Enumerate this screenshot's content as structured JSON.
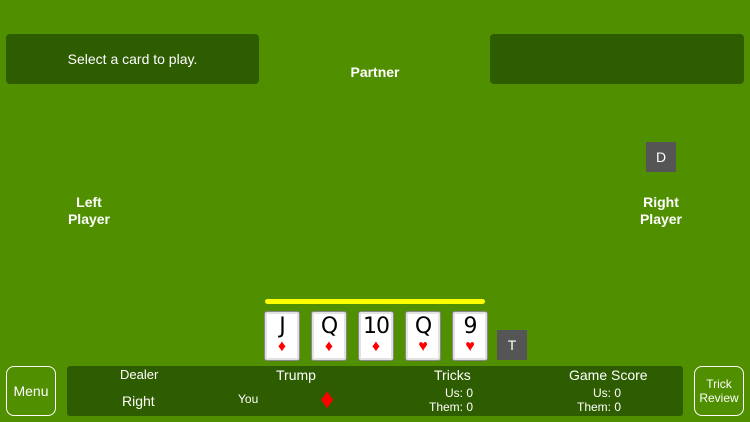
{
  "message": "Select a card to play.",
  "right_message": "",
  "players": {
    "partner": "Partner",
    "left": [
      "Left",
      "Player"
    ],
    "right": [
      "Right",
      "Player"
    ]
  },
  "markers": {
    "dealer": "D",
    "trump": "T"
  },
  "hand": [
    {
      "rank": "J",
      "suit": "♦",
      "suit_name": "diamonds"
    },
    {
      "rank": "Q",
      "suit": "♦",
      "suit_name": "diamonds"
    },
    {
      "rank": "10",
      "suit": "♦",
      "suit_name": "diamonds"
    },
    {
      "rank": "Q",
      "suit": "♥",
      "suit_name": "hearts"
    },
    {
      "rank": "9",
      "suit": "♥",
      "suit_name": "hearts"
    }
  ],
  "buttons": {
    "menu": "Menu",
    "trick_review": [
      "Trick",
      "Review"
    ]
  },
  "status": {
    "dealer_label": "Dealer",
    "dealer_value": "Right",
    "trump_label": "Trump",
    "trump_caller": "You",
    "trump_suit": "♦",
    "tricks_label": "Tricks",
    "tricks_us": "Us:  0",
    "tricks_them": "Them:  0",
    "game_score_label": "Game Score",
    "score_us": "Us:  0",
    "score_them": "Them:  0"
  },
  "colors": {
    "table": "#4f8f00",
    "panel": "#2e5c00",
    "turn_indicator": "#ffff00",
    "red_suit": "#ff0000",
    "marker": "#555555"
  },
  "icons": {
    "trump_suit": "diamond-icon"
  }
}
